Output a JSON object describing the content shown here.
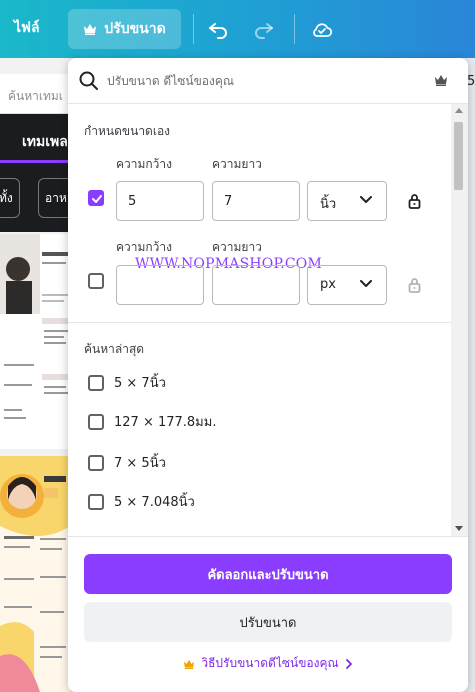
{
  "toolbar": {
    "file_label": "ไฟล์",
    "resize_label": "ปรับขนาด"
  },
  "background": {
    "search_text": "ค้นหาเทมเ",
    "dark_title": "เทมเพลต",
    "chips": [
      "ทั้ง",
      "อาห"
    ],
    "right_number": "5"
  },
  "panel": {
    "search_placeholder": "ปรับขนาด ดีไซน์ของคุณ",
    "custom_size_title": "กำหนดขนาดเอง",
    "rows": [
      {
        "width_label": "ความกว้าง",
        "height_label": "ความยาว",
        "width_value": "5",
        "height_value": "7",
        "unit": "นิ้ว",
        "checked": true
      },
      {
        "width_label": "ความกว้าง",
        "height_label": "ความยาว",
        "width_value": "",
        "height_value": "",
        "unit": "px",
        "checked": false
      }
    ],
    "watermark": "WWW.NOPMASHOP.COM",
    "recent_title": "ค้นหาล่าสุด",
    "recent_items": [
      "5 × 7นิ้ว",
      "127 × 177.8มม.",
      "7 × 5นิ้ว",
      "5 × 7.048นิ้ว"
    ],
    "copy_resize_button": "คัดลอกและปรับขนาด",
    "resize_button": "ปรับขนาด",
    "help_link": "วิธีปรับขนาดดีไซน์ของคุณ"
  },
  "colors": {
    "accent": "#8b3dff",
    "topbar_start": "#1ab8c9",
    "topbar_end": "#2a86d8"
  }
}
